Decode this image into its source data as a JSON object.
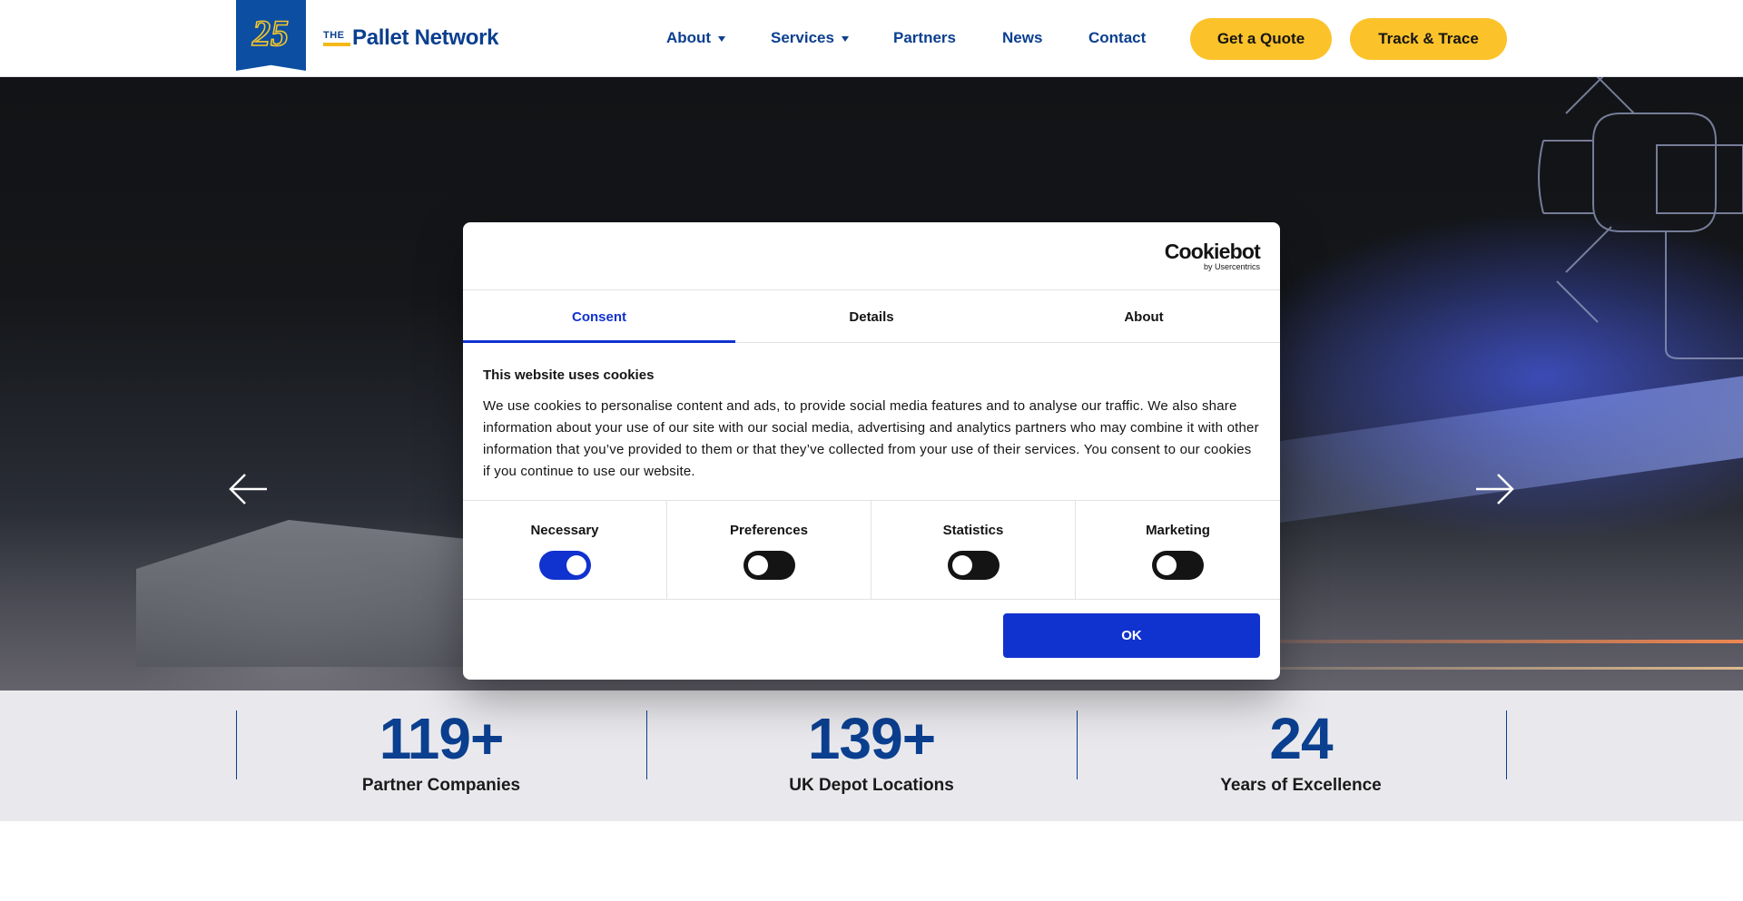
{
  "header": {
    "badge_text": "25",
    "logo_the": "THE",
    "logo_name": "Pallet Network",
    "nav": [
      {
        "label": "About",
        "has_dropdown": true
      },
      {
        "label": "Services",
        "has_dropdown": true
      },
      {
        "label": "Partners",
        "has_dropdown": false
      },
      {
        "label": "News",
        "has_dropdown": false
      },
      {
        "label": "Contact",
        "has_dropdown": false
      }
    ],
    "quote_button": "Get a Quote",
    "track_button": "Track & Trace"
  },
  "hero": {
    "prev_icon": "arrow-left-icon",
    "next_icon": "arrow-right-icon"
  },
  "stats": [
    {
      "value": "119+",
      "label": "Partner Companies"
    },
    {
      "value": "139+",
      "label": "UK Depot Locations"
    },
    {
      "value": "24",
      "label": "Years of Excellence"
    }
  ],
  "cookie_dialog": {
    "brand": "Cookiebot",
    "brand_by": "by Usercentrics",
    "tabs": [
      {
        "label": "Consent",
        "active": true
      },
      {
        "label": "Details",
        "active": false
      },
      {
        "label": "About",
        "active": false
      }
    ],
    "heading": "This website uses cookies",
    "text": "We use cookies to personalise content and ads, to provide social media features and to analyse our traffic. We also share information about your use of our site with our social media, advertising and analytics partners who may combine it with other information that you’ve provided to them or that they’ve collected from your use of their services. You consent to our cookies if you continue to use our website.",
    "categories": [
      {
        "label": "Necessary",
        "enabled": true
      },
      {
        "label": "Preferences",
        "enabled": false
      },
      {
        "label": "Statistics",
        "enabled": false
      },
      {
        "label": "Marketing",
        "enabled": false
      }
    ],
    "ok_button": "OK"
  },
  "colors": {
    "brand_blue": "#0b3f8f",
    "accent_yellow": "#fcc22a",
    "cookie_blue": "#1032cf"
  }
}
